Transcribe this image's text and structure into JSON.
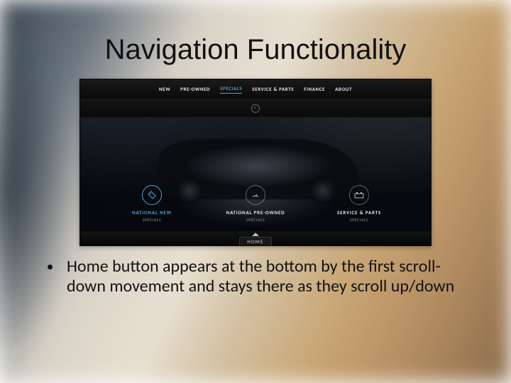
{
  "title": "Navigation Functionality",
  "nav": {
    "items": [
      {
        "label": "NEW",
        "active": false
      },
      {
        "label": "PRE-OWNED",
        "active": false
      },
      {
        "label": "SPECIALS",
        "active": true
      },
      {
        "label": "SERVICE & PARTS",
        "active": false
      },
      {
        "label": "FINANCE",
        "active": false
      },
      {
        "label": "ABOUT",
        "active": false
      }
    ]
  },
  "hero": {
    "items": [
      {
        "icon": "tag-icon",
        "glyph": "⊘",
        "label": "NATIONAL NEW",
        "sub": "SPECIALS",
        "active": true
      },
      {
        "icon": "gauge-icon",
        "glyph": "◔",
        "label": "NATIONAL PRE-OWNED",
        "sub": "SPECIALS",
        "active": false
      },
      {
        "icon": "battery-icon",
        "glyph": "▭",
        "label": "SERVICE & PARTS",
        "sub": "SPECIALS",
        "active": false
      }
    ]
  },
  "home_button": "HOME",
  "bullet": "Home button appears at the bottom by the first scroll-down movement and stays there as they scroll up/down"
}
